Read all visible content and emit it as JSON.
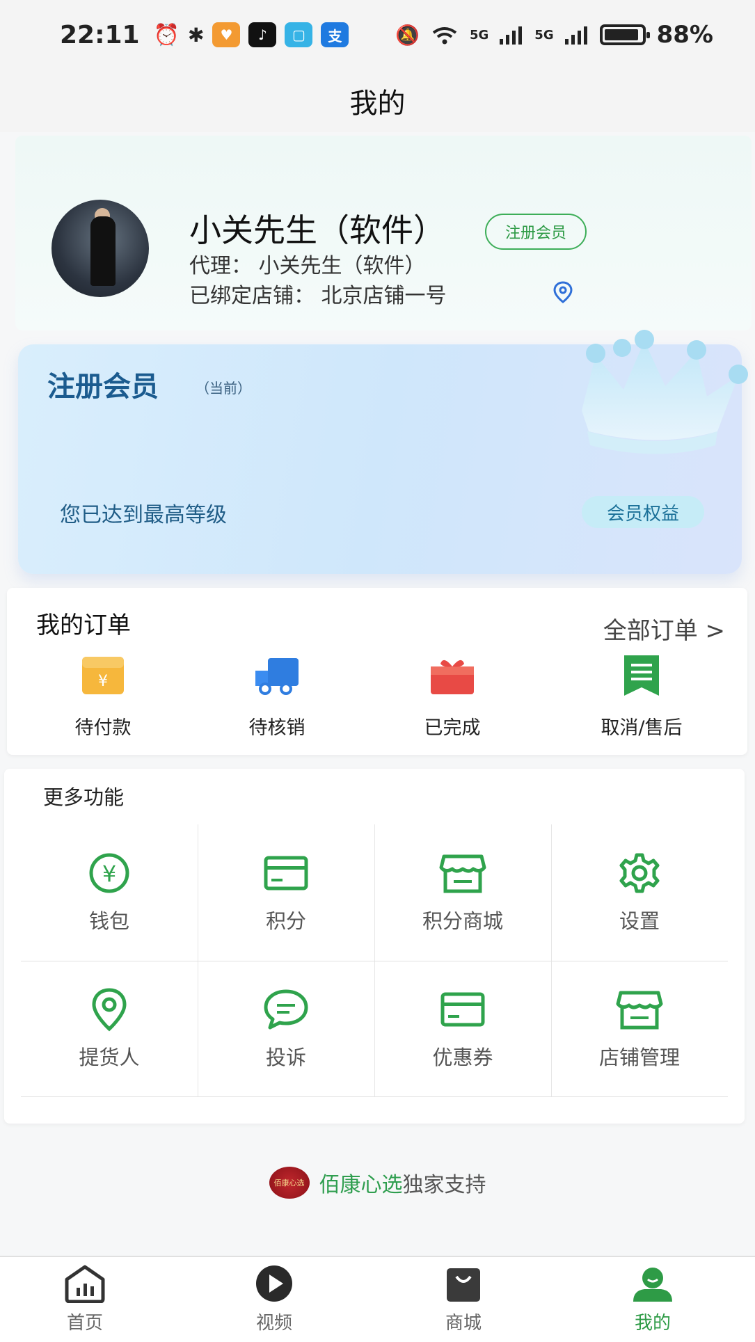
{
  "status_bar": {
    "time": "22:11",
    "signal_1": "5G",
    "signal_2": "5G",
    "battery": "88%"
  },
  "header": {
    "title": "我的"
  },
  "profile": {
    "name": "小关先生（软件）",
    "badge": "注册会员",
    "agent": "代理：  小关先生（软件）",
    "store": "已绑定店铺：  北京店铺一号"
  },
  "member_card": {
    "level": "注册会员",
    "current": "（当前）",
    "desc": "您已达到最高等级",
    "benefits": "会员权益"
  },
  "orders": {
    "title": "我的订单",
    "all": "全部订单 >",
    "items": [
      {
        "label": "待付款",
        "icon": "wallet-yen-icon"
      },
      {
        "label": "待核销",
        "icon": "truck-icon"
      },
      {
        "label": "已完成",
        "icon": "gift-icon"
      },
      {
        "label": "取消/售后",
        "icon": "bookmark-list-icon"
      }
    ]
  },
  "more": {
    "title": "更多功能",
    "items": [
      {
        "label": "钱包",
        "icon": "yen-circle-icon"
      },
      {
        "label": "积分",
        "icon": "card-icon"
      },
      {
        "label": "积分商城",
        "icon": "store-icon"
      },
      {
        "label": "设置",
        "icon": "gear-icon"
      },
      {
        "label": "提货人",
        "icon": "location-pin-icon"
      },
      {
        "label": "投诉",
        "icon": "chat-bubble-icon"
      },
      {
        "label": "优惠券",
        "icon": "card-icon"
      },
      {
        "label": "店铺管理",
        "icon": "store-icon"
      }
    ]
  },
  "support": {
    "logo_text": "佰康心选",
    "brand": "佰康心选",
    "suffix": "独家支持"
  },
  "tabbar": {
    "items": [
      {
        "label": "首页",
        "icon": "home-chart-icon"
      },
      {
        "label": "视频",
        "icon": "play-icon"
      },
      {
        "label": "商城",
        "icon": "shopping-bag-icon"
      },
      {
        "label": "我的",
        "icon": "user-icon"
      }
    ],
    "active_color": "#2e9b46"
  },
  "colors": {
    "accent_green": "#2e9b46",
    "member_blue": "#1b5b8f"
  }
}
